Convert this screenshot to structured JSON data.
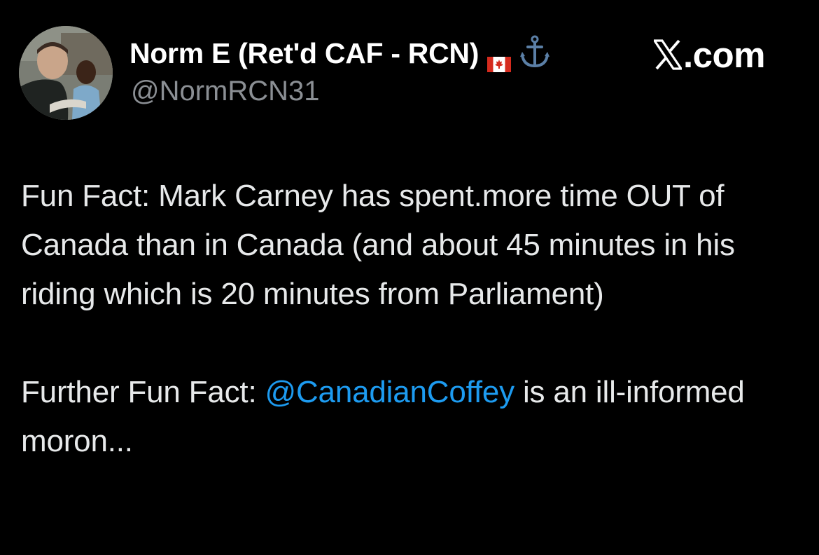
{
  "author": {
    "display_name": "Norm E (Ret'd CAF - RCN)",
    "handle": "@NormRCN31",
    "emoji": [
      "canadian-flag-icon",
      "anchor-icon"
    ]
  },
  "brand": {
    "label": ".com",
    "logo": "x-logo-icon"
  },
  "tweet": {
    "paragraph1": "Fun Fact: Mark Carney has spent.more time OUT of Canada than in Canada (and about 45 minutes in his riding which is 20 minutes from Parliament)",
    "paragraph2_before": "Further Fun Fact: ",
    "mention": "@CanadianCoffey",
    "paragraph2_after": " is an ill-informed moron..."
  },
  "colors": {
    "background": "#000000",
    "text": "#e7e9ea",
    "handle": "#8b8f94",
    "mention": "#1d9bf0",
    "anchor": "#5b7fa6",
    "flag_red": "#d52b1e"
  }
}
